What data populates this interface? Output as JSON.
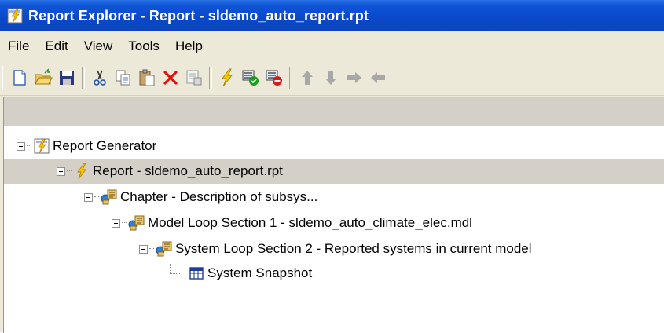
{
  "window": {
    "title": "Report Explorer - Report - sldemo_auto_report.rpt",
    "titlebar_color": "#0b4fd0"
  },
  "menu": {
    "items": [
      "File",
      "Edit",
      "View",
      "Tools",
      "Help"
    ]
  },
  "toolbar": {
    "buttons": [
      {
        "icon": "new-icon"
      },
      {
        "icon": "open-folder-icon"
      },
      {
        "icon": "save-icon"
      },
      {
        "icon": "cut-icon"
      },
      {
        "icon": "copy-icon"
      },
      {
        "icon": "paste-icon"
      },
      {
        "icon": "delete-icon"
      },
      {
        "icon": "properties-icon"
      },
      {
        "icon": "generate-report-icon"
      },
      {
        "icon": "activate-component-icon"
      },
      {
        "icon": "deactivate-component-icon"
      },
      {
        "icon": "move-up-icon"
      },
      {
        "icon": "move-down-icon"
      },
      {
        "icon": "move-right-icon"
      },
      {
        "icon": "move-left-icon"
      }
    ]
  },
  "tree": {
    "nodes": [
      {
        "label": "Report Generator",
        "icon": "report-generator-icon",
        "level": 0,
        "expanded": true
      },
      {
        "label": "Report - sldemo_auto_report.rpt",
        "icon": "report-lightning-icon",
        "level": 1,
        "expanded": true,
        "selected": true
      },
      {
        "label": "Chapter - Description of subsys...",
        "icon": "chapter-icon",
        "level": 2,
        "expanded": true
      },
      {
        "label": "Model Loop Section 1 - sldemo_auto_climate_elec.mdl",
        "icon": "model-loop-icon",
        "level": 3,
        "expanded": true
      },
      {
        "label": "System Loop Section 2 - Reported systems in current model",
        "icon": "system-loop-icon",
        "level": 4,
        "expanded": true
      },
      {
        "label": "System Snapshot",
        "icon": "system-snapshot-icon",
        "level": 5,
        "expanded": false
      }
    ]
  }
}
